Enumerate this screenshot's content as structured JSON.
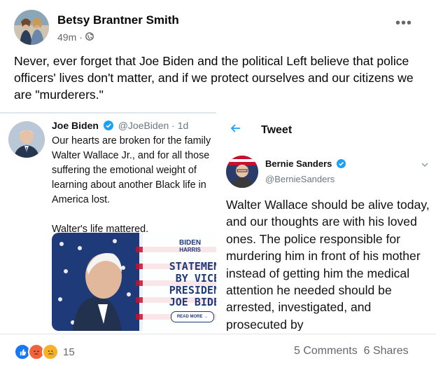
{
  "post": {
    "author": "Betsy Brantner Smith",
    "time": "49m",
    "privacy_icon": "globe-icon",
    "more_icon": "more-options-icon",
    "text": "Never, ever forget that Joe Biden and the political Left believe that police officers' lives don't matter, and if we protect ourselves and our citizens we are \"murderers.\""
  },
  "left_tweet": {
    "name": "Joe Biden",
    "handle": "@JoeBiden",
    "time": "1d",
    "paragraph1": "Our hearts are broken for the family Walter Wallace Jr., and for all those suffering the emotional weight of learning about another Black life in America lost.",
    "paragraph2": "Walter's life mattered.",
    "card": {
      "logo_line1": "BIDEN",
      "logo_line2": "HARRIS",
      "line1": "STATEMEN",
      "line2": "BY VICE",
      "line3": "PRESIDEN",
      "line4": "JOE BIDE",
      "button": "READ MORE →"
    }
  },
  "right_tweet": {
    "header_title": "Tweet",
    "name": "Bernie Sanders",
    "handle": "@BernieSanders",
    "text": "Walter Wallace should be alive today, and our thoughts are with his loved ones. The police responsible for murdering him in front of his mother instead of getting him the medical attention he needed should be arrested, investigated, and prosecuted by"
  },
  "footer": {
    "reaction_count": "15",
    "comments": "5 Comments",
    "shares": "6 Shares"
  },
  "colors": {
    "twitter_blue": "#1da1f2",
    "like_blue": "#1877f2",
    "angry_orange": "#f0633d",
    "sad_yellow": "#f7b125"
  }
}
